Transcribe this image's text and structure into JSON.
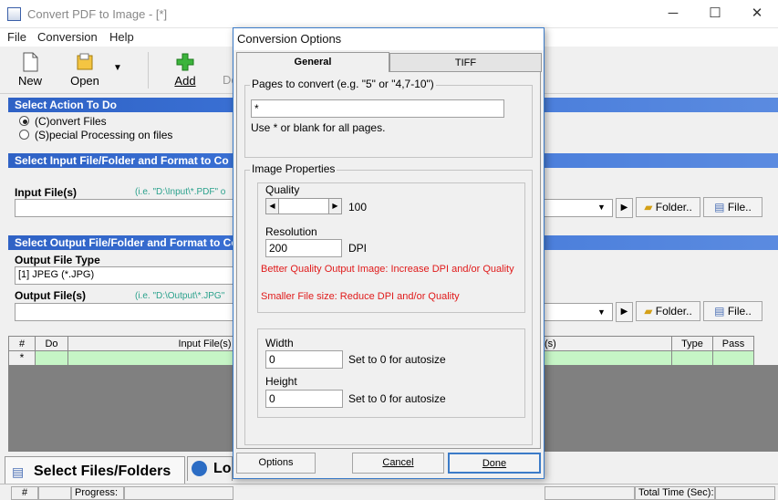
{
  "window": {
    "title": "Convert PDF to Image - [*]",
    "minimize": "─",
    "maximize": "☐",
    "close": "✕"
  },
  "menu": [
    "File",
    "Conversion",
    "Help"
  ],
  "toolbar": {
    "new": "New",
    "open": "Open",
    "add": "Add",
    "partial": "De"
  },
  "action": {
    "header": "Select Action To Do",
    "convert": "(C)onvert Files",
    "special": "(S)pecial Processing on files"
  },
  "input": {
    "header": "Select Input File/Folder and Format to Co",
    "label": "Input File(s)",
    "hint": "(i.e. \"D:\\Input\\*.PDF\"  o",
    "folder_btn": "Folder..",
    "file_btn": "File.."
  },
  "output": {
    "header": "Select Output File/Folder and Format to Co",
    "type_label": "Output File Type",
    "type_value": "[1] JPEG (*.JPG)",
    "file_label": "Output File(s)",
    "hint": "(i.e. \"D:\\Output\\*.JPG\"",
    "folder_btn": "Folder..",
    "file_btn": "File.."
  },
  "grid": {
    "col_num": "#",
    "col_do": "Do",
    "col_input": "Input File(s)",
    "col_output_partial": "(s)",
    "col_type": "Type",
    "col_pass": "Pass",
    "new_row_marker": "*"
  },
  "bottom_tabs": {
    "select": "Select Files/Folders",
    "log_partial": "Lo"
  },
  "status": {
    "num": "#",
    "progress": "Progress:",
    "total_time": "Total Time (Sec):"
  },
  "dialog": {
    "title": "Conversion Options",
    "tab_general": "General",
    "tab_tiff": "TIFF",
    "pages_group": "Pages to convert (e.g. \"5\" or \"4,7-10\")",
    "pages_value": "*",
    "pages_hint": "Use * or blank for all pages.",
    "image_group": "Image Properties",
    "quality_label": "Quality",
    "quality_value": "100",
    "quality_fraction": 1.0,
    "resolution_label": "Resolution",
    "resolution_value": "200",
    "resolution_unit": "DPI",
    "better_quality": "Better Quality Output Image: Increase DPI and/or Quality",
    "smaller_file": "Smaller File size: Reduce DPI and/or Quality",
    "width_label": "Width",
    "width_value": "0",
    "width_hint": "Set to 0 for autosize",
    "height_label": "Height",
    "height_value": "0",
    "height_hint": "Set to 0 for autosize",
    "options_btn": "Options",
    "cancel_btn": "Cancel",
    "done_btn": "Done"
  },
  "colors": {
    "section_header": "#2f62c5",
    "grid_row": "#c6f5c6",
    "warning": "#e01a1a",
    "hint": "#2aa18c"
  }
}
